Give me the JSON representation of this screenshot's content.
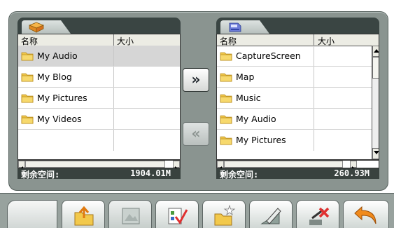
{
  "left_panel": {
    "tab_icon": "book-folder-icon",
    "columns": [
      "名称",
      "大小"
    ],
    "rows": [
      {
        "name": "My Audio",
        "size": ""
      },
      {
        "name": "My Blog",
        "size": ""
      },
      {
        "name": "My Pictures",
        "size": ""
      },
      {
        "name": "My Videos",
        "size": ""
      }
    ],
    "free_label": "剩余空间:",
    "free_value": "1904.01M"
  },
  "right_panel": {
    "tab_icon": "memory-card-icon",
    "columns": [
      "名称",
      "大小"
    ],
    "rows": [
      {
        "name": "CaptureScreen",
        "size": ""
      },
      {
        "name": "Map",
        "size": ""
      },
      {
        "name": "Music",
        "size": ""
      },
      {
        "name": "My Audio",
        "size": ""
      },
      {
        "name": "My Pictures",
        "size": ""
      }
    ],
    "free_label": "剩余空间:",
    "free_value": "260.93M"
  },
  "move_buttons": {
    "to_right": "»",
    "to_left": "«"
  },
  "toolbar_icons": [
    "move-folder-up-icon",
    "picture-icon",
    "checklist-icon",
    "new-folder-icon",
    "rename-pen-icon",
    "delete-icon",
    "back-arrow-icon"
  ],
  "colors": {
    "frame": "#8a9490",
    "selected_row": "#d6d6d6",
    "folder": "#f2c94c",
    "back_arrow": "#f08a1c",
    "delete_x": "#e03030"
  }
}
